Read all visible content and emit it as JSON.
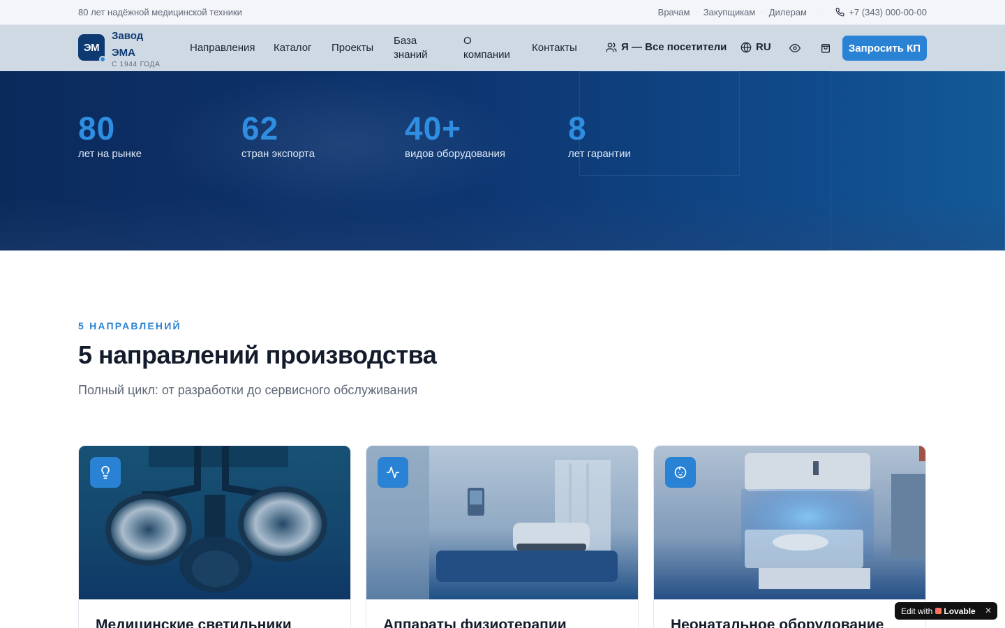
{
  "topbar": {
    "tagline": "80 лет надёжной медицинской техники",
    "links": [
      "Врачам",
      "Закупщикам",
      "Дилерам"
    ],
    "phone": "+7 (343) 000-00-00"
  },
  "header": {
    "logo_mark": "ЭМ",
    "brand_name": "Завод ЭМА",
    "brand_since": "С 1944 ГОДА",
    "nav": [
      "Направления",
      "Каталог",
      "Проекты",
      "База знаний",
      "О компании",
      "Контакты"
    ],
    "audience": "Я — Все посетители",
    "lang": "RU",
    "cta": "Запросить КП"
  },
  "stats": [
    {
      "value": "80",
      "label": "лет на рынке"
    },
    {
      "value": "62",
      "label": "стран экспорта"
    },
    {
      "value": "40+",
      "label": "видов оборудования"
    },
    {
      "value": "8",
      "label": "лет гарантии"
    }
  ],
  "section": {
    "eyebrow": "5 НАПРАВЛЕНИЙ",
    "title": "5 направлений производства",
    "subtitle": "Полный цикл: от разработки до сервисного обслуживания"
  },
  "cards": [
    {
      "title": "Медицинские светильники",
      "icon": "lightbulb-icon"
    },
    {
      "title": "Аппараты физиотерапии",
      "icon": "activity-icon"
    },
    {
      "title": "Неонатальное оборудование",
      "icon": "baby-icon"
    }
  ],
  "lovable": {
    "prefix": "Edit with",
    "brand": "Lovable"
  },
  "colors": {
    "accent": "#2a82d4",
    "navy": "#0e3a72"
  }
}
